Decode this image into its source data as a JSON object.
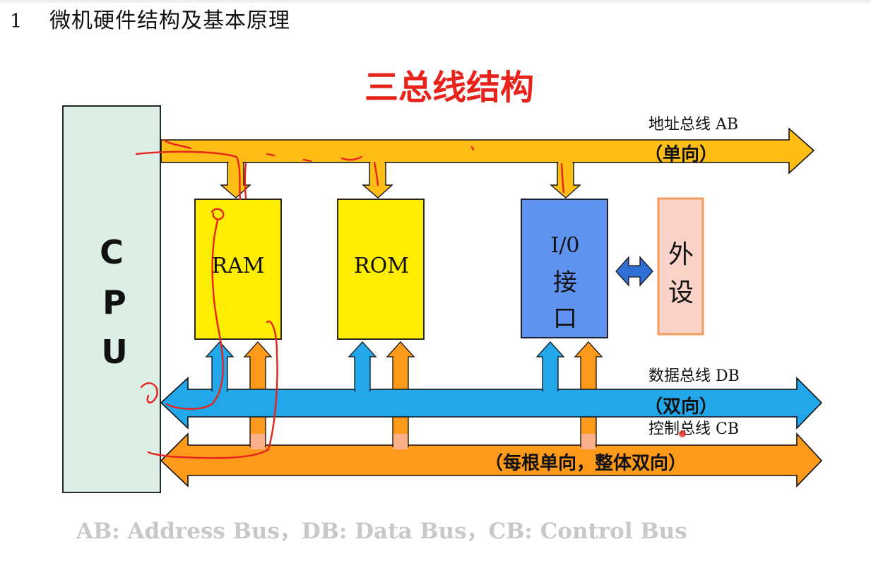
{
  "slide": {
    "section_number": "1",
    "section_title": "微机硬件结构及基本原理",
    "diagram_title": "三总线结构",
    "footer": "AB: Address Bus，DB: Data Bus，CB: Control Bus"
  },
  "blocks": {
    "cpu": [
      "C",
      "P",
      "U"
    ],
    "ram": "RAM",
    "rom": "ROM",
    "io": [
      "I/0",
      "接",
      "口"
    ],
    "peripheral": [
      "外",
      "设"
    ]
  },
  "buses": {
    "address": {
      "label": "地址总线 AB",
      "direction": "（单向）"
    },
    "data": {
      "label": "数据总线 DB",
      "direction": "（双向）"
    },
    "control": {
      "label": "控制总线 CB",
      "direction": "（每根单向，整体双向）"
    }
  },
  "colors": {
    "cpu_fill": "#dcefe4",
    "memory_fill": "#ffee00",
    "io_fill": "#5f93f0",
    "peripheral_fill": "#fbd2c8",
    "peripheral_border": "#f39a5c",
    "address_bus": "#ffbe16",
    "data_bus": "#22a8ea",
    "control_bus": "#fd9a1c",
    "title_red": "#e8231c",
    "annotation_red": "#e8231c"
  }
}
